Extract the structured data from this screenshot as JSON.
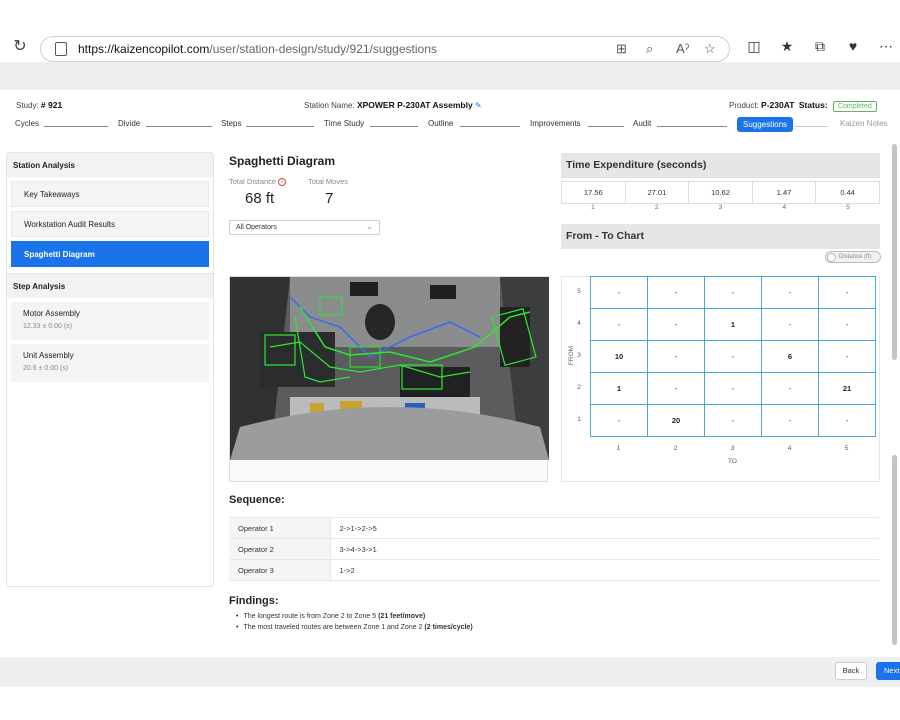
{
  "browser": {
    "url_host": "https://kaizencopilot.com",
    "url_path": "/user/station-design/study/921/suggestions",
    "icons": [
      "refresh-icon",
      "lock-icon",
      "grid-icon",
      "zoom-icon",
      "read-aloud-icon",
      "favorite-icon",
      "split-screen-icon",
      "favorites-list-icon",
      "collections-icon",
      "extensions-icon",
      "more-icon"
    ]
  },
  "header": {
    "study_label": "Study:",
    "study_value": "# 921",
    "station_label": "Station Name:",
    "station_value": "XPOWER P-230AT Assembly",
    "product_label": "Product:",
    "product_value": "P-230AT",
    "status_label": "Status:",
    "status_value": "Completed"
  },
  "stepper": {
    "steps": [
      "Cycles",
      "Divide",
      "Steps",
      "Time Study",
      "Outline",
      "Improvements",
      "Audit",
      "Suggestions",
      "Kaizen Notes"
    ],
    "active": "Suggestions"
  },
  "sidebar": {
    "station_analysis_title": "Station Analysis",
    "station_items": [
      "Key Takeaways",
      "Workstation Audit Results",
      "Spaghetti Diagram"
    ],
    "active_item": "Spaghetti Diagram",
    "step_analysis_title": "Step Analysis",
    "steps": [
      {
        "name": "Motor Assembly",
        "time": "12.33 ± 0.00 (s)"
      },
      {
        "name": "Unit Assembly",
        "time": "20.6 ± 0.00 (s)"
      }
    ]
  },
  "main": {
    "title": "Spaghetti Diagram",
    "total_distance_label": "Total Distance",
    "total_distance_value": "68 ft",
    "total_moves_label": "Total Moves",
    "total_moves_value": "7",
    "operator_select": "All Operators",
    "sequence_title": "Sequence:",
    "sequence": [
      {
        "operator": "Operator 1",
        "route": "2->1->2->5"
      },
      {
        "operator": "Operator 2",
        "route": "3->4->3->1"
      },
      {
        "operator": "Operator 3",
        "route": "1->2"
      }
    ],
    "findings_title": "Findings:",
    "findings": [
      {
        "text": "The longest route is from Zone 2 to Zone 5 ",
        "bold": "(21 feet/move)"
      },
      {
        "text": "The most traveled routes are between Zone 1 and Zone 2 ",
        "bold": "(2 times/cycle)"
      }
    ]
  },
  "time_expenditure": {
    "title": "Time Expenditure (seconds)",
    "values": [
      "17.56",
      "27.01",
      "10.62",
      "1.47",
      "0.44"
    ],
    "zones": [
      "1",
      "2",
      "3",
      "4",
      "5"
    ]
  },
  "from_to": {
    "title": "From - To Chart",
    "toggle_label": "Distance (ft)",
    "from_label": "FROM",
    "to_label": "TO",
    "row_labels": [
      "5",
      "4",
      "3",
      "2",
      "1"
    ],
    "col_labels": [
      "1",
      "2",
      "3",
      "4",
      "5"
    ],
    "rows": [
      [
        "-",
        "-",
        "-",
        "-",
        "-"
      ],
      [
        "-",
        "-",
        "1",
        "-",
        "-"
      ],
      [
        "10",
        "-",
        "-",
        "6",
        "-"
      ],
      [
        "1",
        "-",
        "-",
        "-",
        "21"
      ],
      [
        "-",
        "20",
        "-",
        "-",
        "-"
      ]
    ]
  },
  "footer": {
    "back_label": "Back",
    "next_label": "Next"
  },
  "colors": {
    "accent": "#1a73e8",
    "status_green": "#5cb85c",
    "grid_blue": "#4aa9d6",
    "path_green": "#2ee82e",
    "path_blue": "#3a6cf0"
  }
}
